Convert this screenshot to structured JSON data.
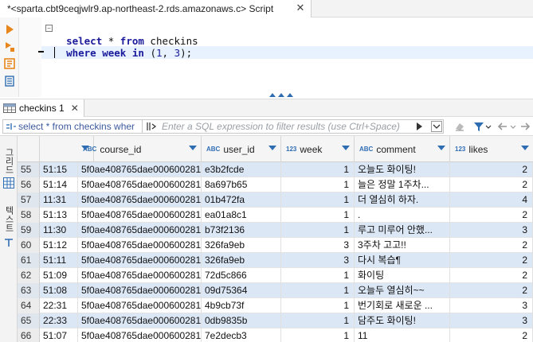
{
  "editor": {
    "tab_title": "*<sparta.cbt9ceqjwlr9.ap-northeast-2.rds.amazonaws.c> Script",
    "close_glyph": "✕",
    "line1_kw1": "select",
    "line1_rest": " * ",
    "line1_kw2": "from",
    "line1_tbl": " checkins",
    "line2_kw1": "where",
    "line2_col": " week ",
    "line2_kw2": "in",
    "line2_open": " (",
    "line2_n1": "1",
    "line2_comma": ", ",
    "line2_n2": "3",
    "line2_close": ");"
  },
  "results": {
    "tab_label": "checkins 1",
    "close_glyph": "✕",
    "query_text": "select * from checkins wher",
    "filter_placeholder": "Enter a SQL expression to filter results (use Ctrl+Space)"
  },
  "sidebar": {
    "grid_label": "그리드",
    "text_label": "텍스트"
  },
  "grid": {
    "columns": [
      {
        "type": "",
        "label": ""
      },
      {
        "type": "ABC",
        "label": "course_id"
      },
      {
        "type": "ABC",
        "label": "user_id"
      },
      {
        "type": "123",
        "label": "week"
      },
      {
        "type": "ABC",
        "label": "comment"
      },
      {
        "type": "123",
        "label": "likes"
      }
    ],
    "rows": [
      {
        "n": "55",
        "t": "51:15",
        "course": "5f0ae408765dae0006002816",
        "user": "e3b2fcde",
        "week": "1",
        "comment": "오늘도 화이팅!",
        "likes": "2"
      },
      {
        "n": "56",
        "t": "51:14",
        "course": "5f0ae408765dae0006002816",
        "user": "8a697b65",
        "week": "1",
        "comment": "늘은 정말 1주차...",
        "likes": "2"
      },
      {
        "n": "57",
        "t": "11:31",
        "course": "5f0ae408765dae0006002817",
        "user": "01b472fa",
        "week": "1",
        "comment": "더 열심히 하자.",
        "likes": "4"
      },
      {
        "n": "58",
        "t": "51:13",
        "course": "5f0ae408765dae0006002816",
        "user": "ea01a8c1",
        "week": "1",
        "comment": ".",
        "likes": "2"
      },
      {
        "n": "59",
        "t": "11:30",
        "course": "5f0ae408765dae0006002817",
        "user": "b73f2136",
        "week": "1",
        "comment": "루고 미루어 안했...",
        "likes": "3"
      },
      {
        "n": "60",
        "t": "51:12",
        "course": "5f0ae408765dae0006002816",
        "user": "326fa9eb",
        "week": "3",
        "comment": "3주차 고고!!",
        "likes": "2"
      },
      {
        "n": "61",
        "t": "51:11",
        "course": "5f0ae408765dae0006002816",
        "user": "326fa9eb",
        "week": "3",
        "comment": "다시 복습¶",
        "likes": "2"
      },
      {
        "n": "62",
        "t": "51:09",
        "course": "5f0ae408765dae0006002816",
        "user": "72d5c866",
        "week": "1",
        "comment": "화이팅",
        "likes": "2"
      },
      {
        "n": "63",
        "t": "51:08",
        "course": "5f0ae408765dae0006002816",
        "user": "09d75364",
        "week": "1",
        "comment": "오늘두 열심히~~",
        "likes": "2"
      },
      {
        "n": "64",
        "t": "22:31",
        "course": "5f0ae408765dae0006002817",
        "user": "4b9cb73f",
        "week": "1",
        "comment": "번기회로 새로운 ...",
        "likes": "3"
      },
      {
        "n": "65",
        "t": "22:33",
        "course": "5f0ae408765dae0006002817",
        "user": "0db9835b",
        "week": "1",
        "comment": "담주도 화이팅!",
        "likes": "3"
      },
      {
        "n": "66",
        "t": "51:07",
        "course": "5f0ae408765dae0006002816",
        "user": "7e2decb3",
        "week": "1",
        "comment": "11",
        "likes": "2"
      }
    ]
  }
}
